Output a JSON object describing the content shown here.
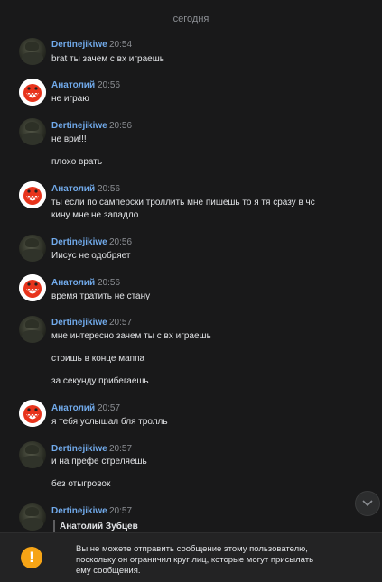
{
  "date_separator": "сегодня",
  "users": {
    "dert": "Dertinejikiwe",
    "anat": "Анатолий"
  },
  "messages": [
    {
      "author": "Dertinejikiwe",
      "time": "20:54",
      "lines": [
        "brat ты зачем с вх играешь"
      ]
    },
    {
      "author": "Анатолий",
      "time": "20:56",
      "lines": [
        "не играю"
      ]
    },
    {
      "author": "Dertinejikiwe",
      "time": "20:56",
      "lines": [
        "не ври!!!",
        "плохо врать"
      ]
    },
    {
      "author": "Анатолий",
      "time": "20:56",
      "lines": [
        "ты если по самперски троллить мне пишешь то я тя сразу в чс",
        "кину мне не западло"
      ]
    },
    {
      "author": "Dertinejikiwe",
      "time": "20:56",
      "lines": [
        "Иисус не одобряет"
      ]
    },
    {
      "author": "Анатолий",
      "time": "20:56",
      "lines": [
        "время тратить не стану"
      ]
    },
    {
      "author": "Dertinejikiwe",
      "time": "20:57",
      "lines": [
        "мне интересно зачем ты с вх играешь",
        "стоишь в конце маппа",
        "за секунду прибегаешь"
      ]
    },
    {
      "author": "Анатолий",
      "time": "20:57",
      "lines": [
        "я тебя услышал бля тролль"
      ]
    },
    {
      "author": "Dertinejikiwe",
      "time": "20:57",
      "lines": [
        "и на префе стреляешь",
        "без отыгровок"
      ]
    },
    {
      "author": "Dertinejikiwe",
      "time": "20:57",
      "quote_author": "Анатолий Зубцев"
    }
  ],
  "notice": {
    "lines": [
      "Вы не можете отправить сообщение этому пользователю,",
      "поскольку он ограничил круг лиц, которые могут присылать",
      "ему сообщения."
    ],
    "icon": "warning-icon",
    "icon_glyph": "!",
    "icon_color": "#f6a416"
  },
  "scroll_down_icon": "chevron-down-icon",
  "colors": {
    "background": "#19191a",
    "author": "#71aaeb",
    "text": "#e1e3e6",
    "muted": "#8b8e93"
  }
}
